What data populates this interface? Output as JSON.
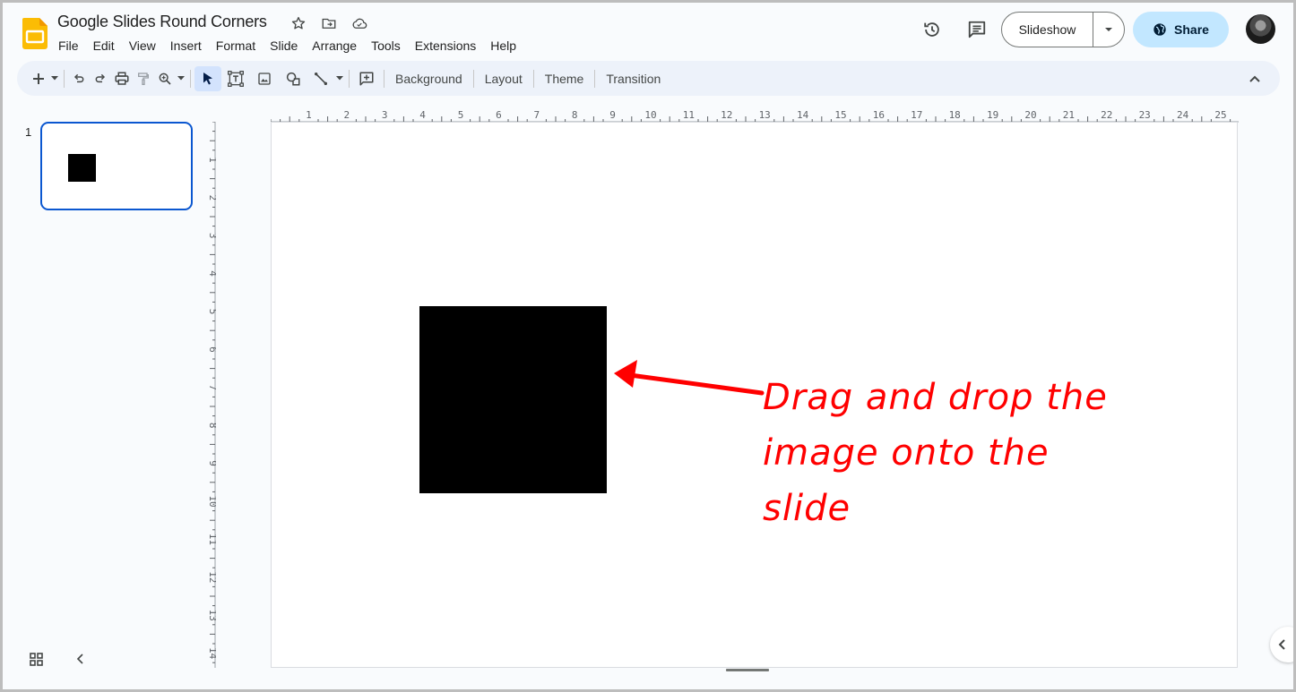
{
  "header": {
    "doc_title": "Google Slides Round Corners",
    "title_icons": [
      "star-icon",
      "move-to-folder-icon",
      "cloud-saved-icon"
    ],
    "menu": [
      "File",
      "Edit",
      "View",
      "Insert",
      "Format",
      "Slide",
      "Arrange",
      "Tools",
      "Extensions",
      "Help"
    ],
    "slideshow_label": "Slideshow",
    "share_label": "Share"
  },
  "toolbar": {
    "icons": [
      "new-slide-icon",
      "undo-icon",
      "redo-icon",
      "print-icon",
      "paint-format-icon",
      "zoom-icon",
      "select-icon",
      "text-box-icon",
      "image-icon",
      "shape-icon",
      "line-icon",
      "comment-add-icon"
    ],
    "buttons": [
      "Background",
      "Layout",
      "Theme",
      "Transition"
    ]
  },
  "filmstrip": {
    "slides": [
      {
        "number": "1"
      }
    ]
  },
  "rulers": {
    "horizontal": [
      "1",
      "2",
      "3",
      "4",
      "5",
      "6",
      "7",
      "8",
      "9",
      "10",
      "11",
      "12",
      "13",
      "14",
      "15",
      "16",
      "17",
      "18",
      "19",
      "20",
      "21",
      "22",
      "23",
      "24",
      "25"
    ],
    "vertical": [
      "1",
      "2",
      "3",
      "4",
      "5",
      "6",
      "7",
      "8",
      "9",
      "10",
      "11",
      "12",
      "13",
      "14"
    ]
  },
  "slide": {
    "annotation_line1": "Drag and drop the",
    "annotation_line2": "image onto the slide",
    "annotation_color": "#ff0000"
  },
  "colors": {
    "accent": "#0b57d0",
    "share_bg": "#c2e7ff",
    "toolbar_bg": "#edf2fa",
    "app_bg": "#f9fbfd"
  }
}
